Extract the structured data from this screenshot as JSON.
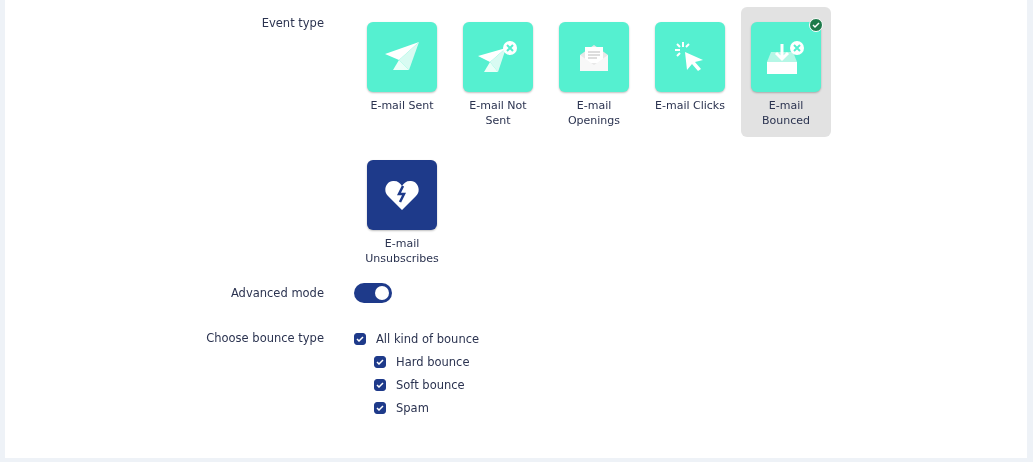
{
  "event_type": {
    "label": "Event type",
    "options": [
      {
        "label": "E-mail Sent",
        "kind": "sent",
        "color": "#55f0d0",
        "selected": false
      },
      {
        "label": "E-mail Not Sent",
        "kind": "not_sent",
        "color": "#55f0d0",
        "selected": false
      },
      {
        "label": "E-mail Openings",
        "kind": "openings",
        "color": "#55f0d0",
        "selected": false
      },
      {
        "label": "E-mail Clicks",
        "kind": "clicks",
        "color": "#55f0d0",
        "selected": false
      },
      {
        "label": "E-mail Bounced",
        "kind": "bounced",
        "color": "#55f0d0",
        "selected": true
      },
      {
        "label": "E-mail Unsubscribes",
        "kind": "unsubscribes",
        "color": "#1e3a8a",
        "selected": false
      }
    ]
  },
  "advanced_mode": {
    "label": "Advanced mode",
    "on": true
  },
  "bounce_type": {
    "label": "Choose bounce type",
    "options": [
      {
        "label": "All kind of bounce",
        "checked": true,
        "children": [
          {
            "label": "Hard bounce",
            "checked": true
          },
          {
            "label": "Soft bounce",
            "checked": true
          },
          {
            "label": "Spam",
            "checked": true
          }
        ]
      }
    ]
  }
}
